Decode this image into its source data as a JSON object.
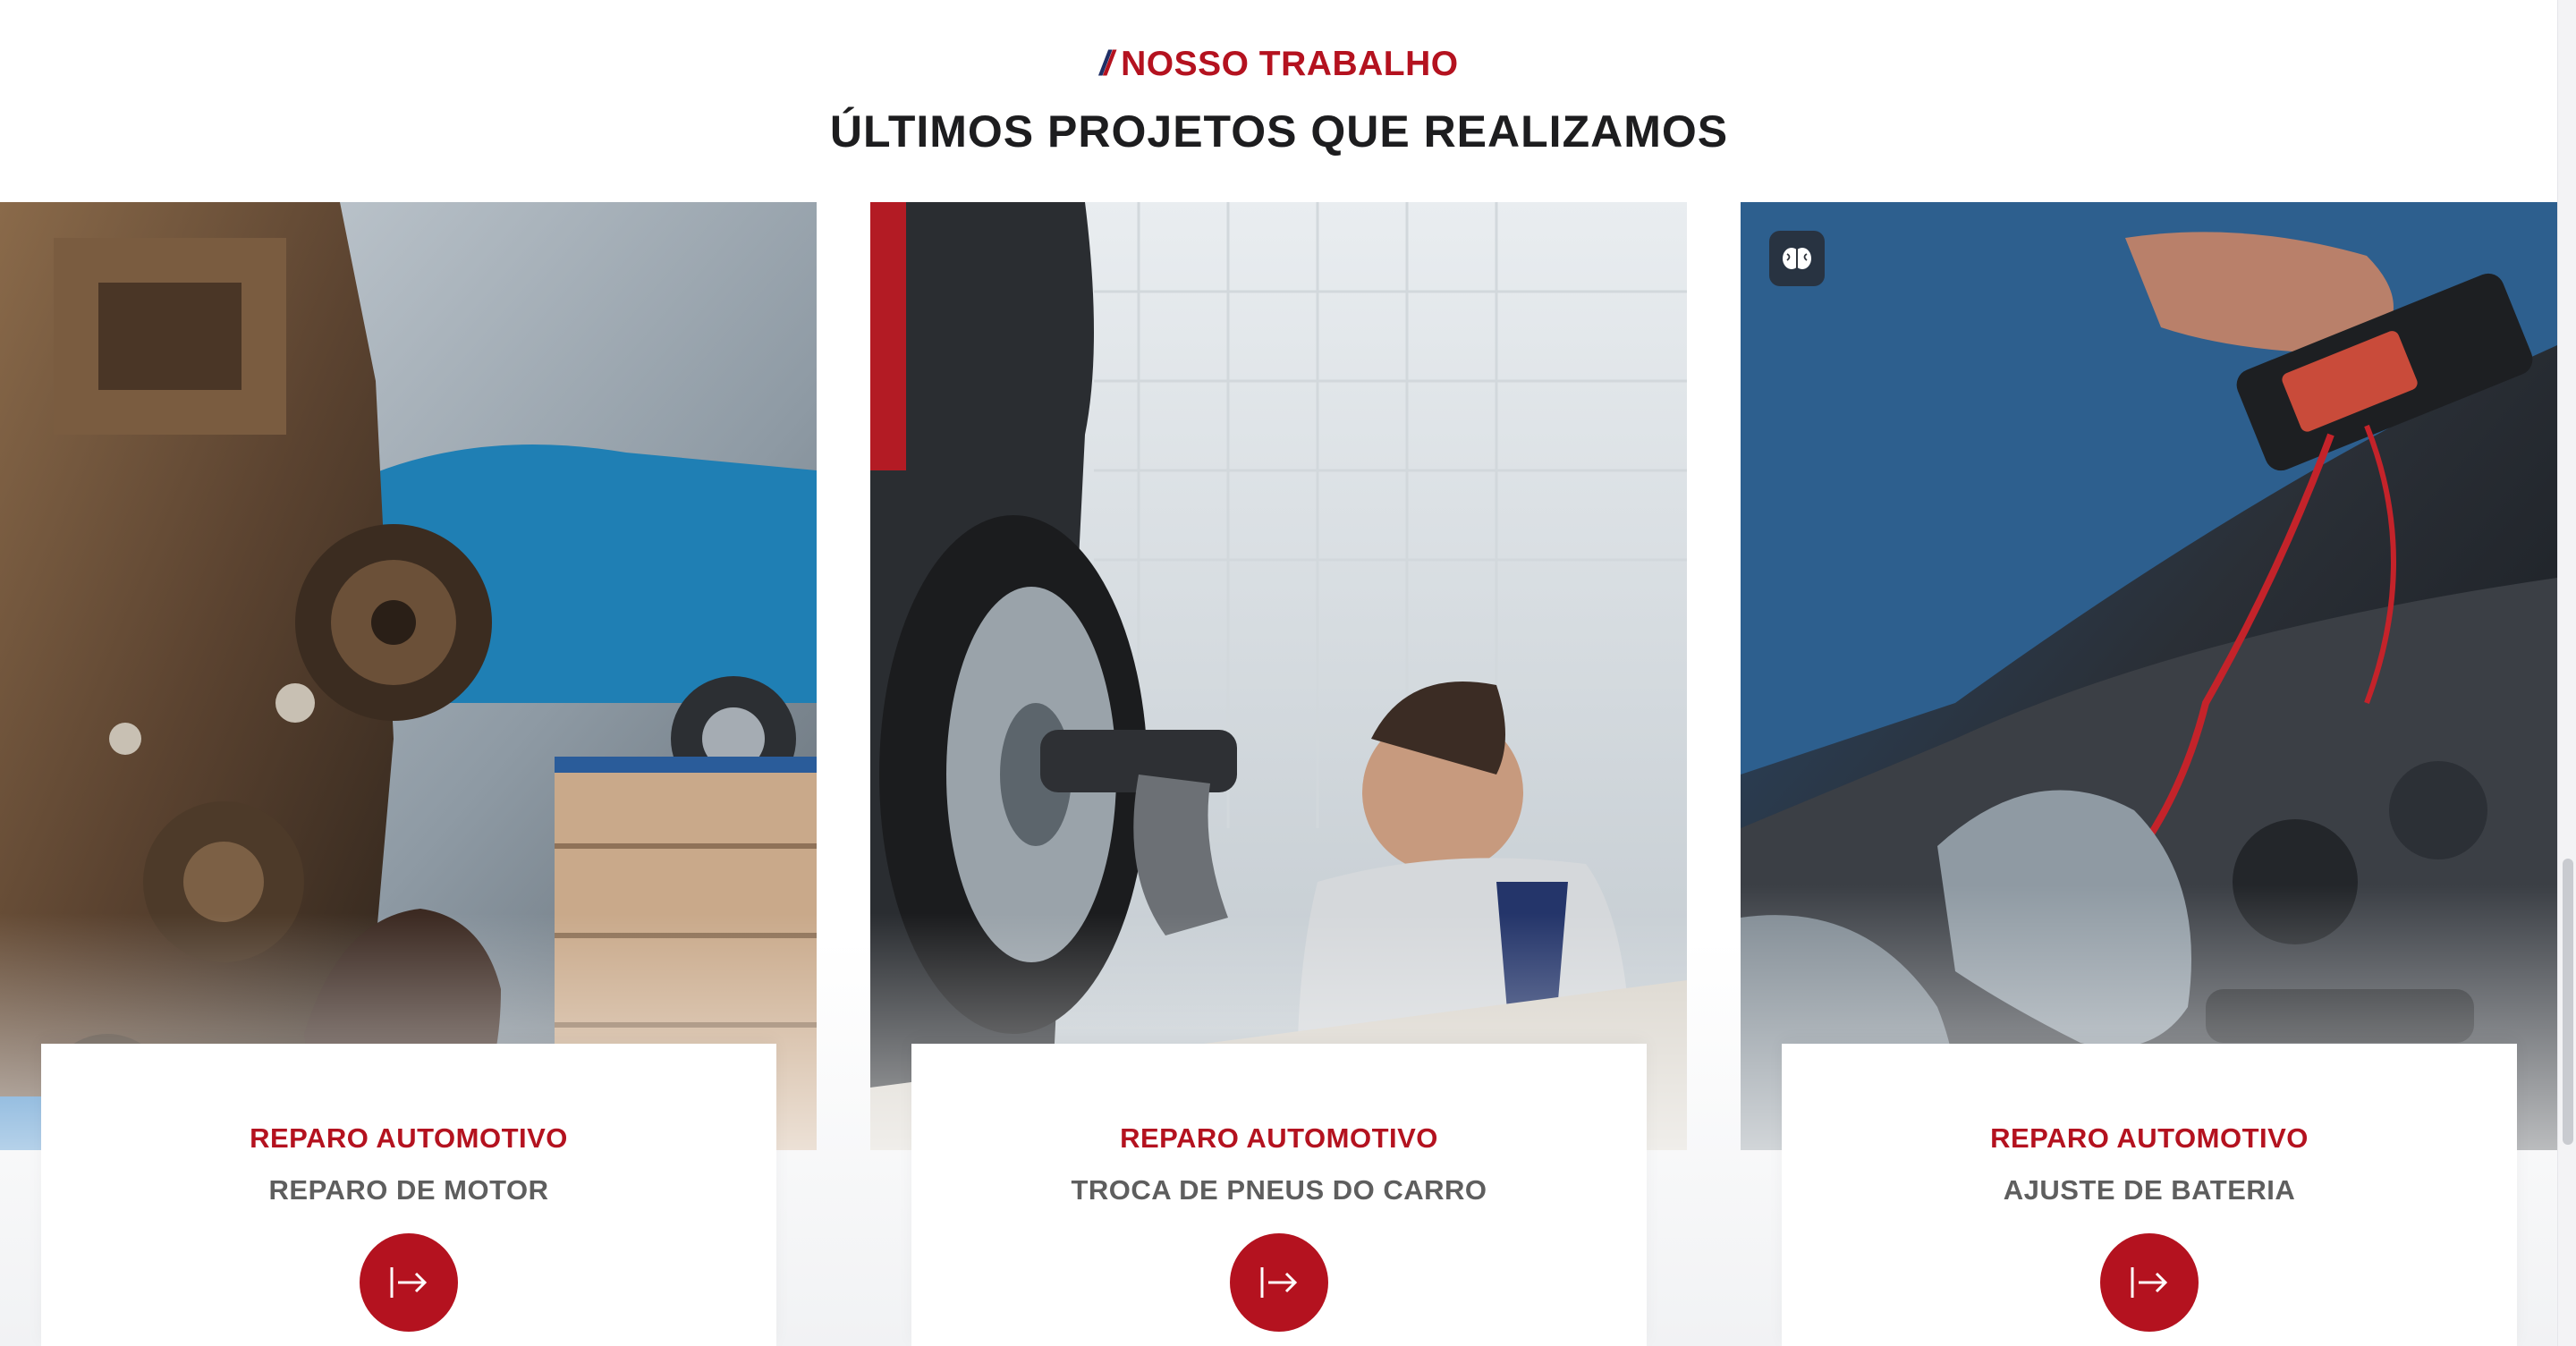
{
  "section": {
    "eyebrow_label": "NOSSO TRABALHO",
    "heading": "ÚLTIMOS PROJETOS QUE REALIZAMOS"
  },
  "projects": [
    {
      "category": "REPARO AUTOMOTIVO",
      "title": "REPARO DE MOTOR",
      "image_icon": "engine-repair-photo",
      "button_icon": "arrow-right-icon"
    },
    {
      "category": "REPARO AUTOMOTIVO",
      "title": "TROCA DE PNEUS DO CARRO",
      "image_icon": "tire-change-photo",
      "button_icon": "arrow-right-icon"
    },
    {
      "category": "REPARO AUTOMOTIVO",
      "title": "AJUSTE DE BATERIA",
      "image_icon": "battery-adjust-photo",
      "button_icon": "arrow-right-icon"
    }
  ],
  "colors": {
    "accent": "#b4121f",
    "navy": "#1f2f66",
    "heading": "#1d1d1f",
    "subtitle": "#5e5e5e"
  }
}
